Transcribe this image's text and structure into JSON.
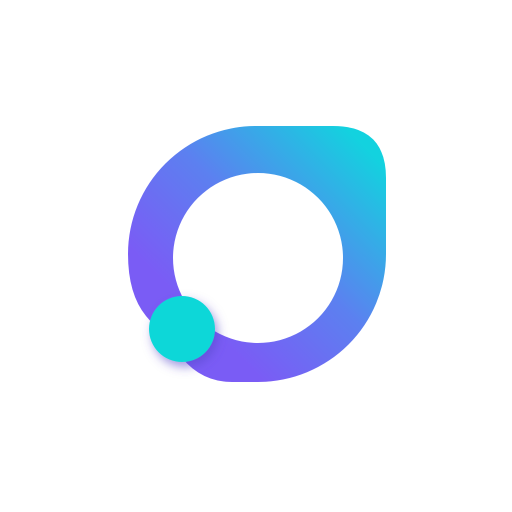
{
  "logo": {
    "icon": "ring-with-dot-logo",
    "colors": {
      "background": "#ffffff",
      "gradient_start": "#7A5CF5",
      "gradient_end": "#13D2DF",
      "dot": "#10D7D8",
      "dot_shadow": "#5648C9"
    }
  }
}
